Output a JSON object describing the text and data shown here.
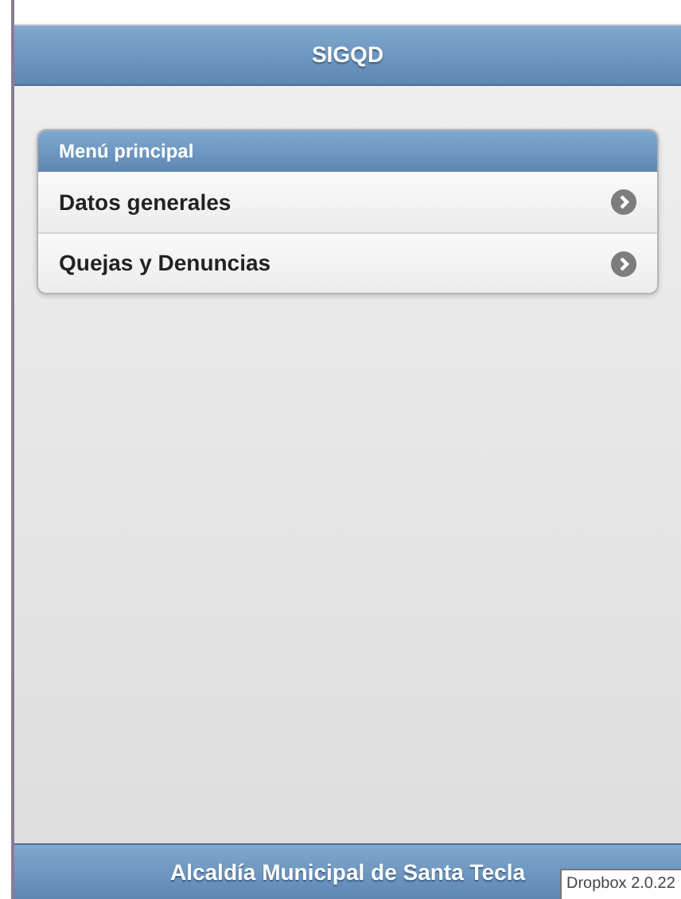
{
  "header": {
    "title": "SIGQD"
  },
  "menu": {
    "title": "Menú principal",
    "items": [
      {
        "label": "Datos generales"
      },
      {
        "label": "Quejas y Denuncias"
      }
    ]
  },
  "footer": {
    "text": "Alcaldía Municipal de Santa Tecla"
  },
  "tooltip": {
    "text": "Dropbox 2.0.22"
  }
}
